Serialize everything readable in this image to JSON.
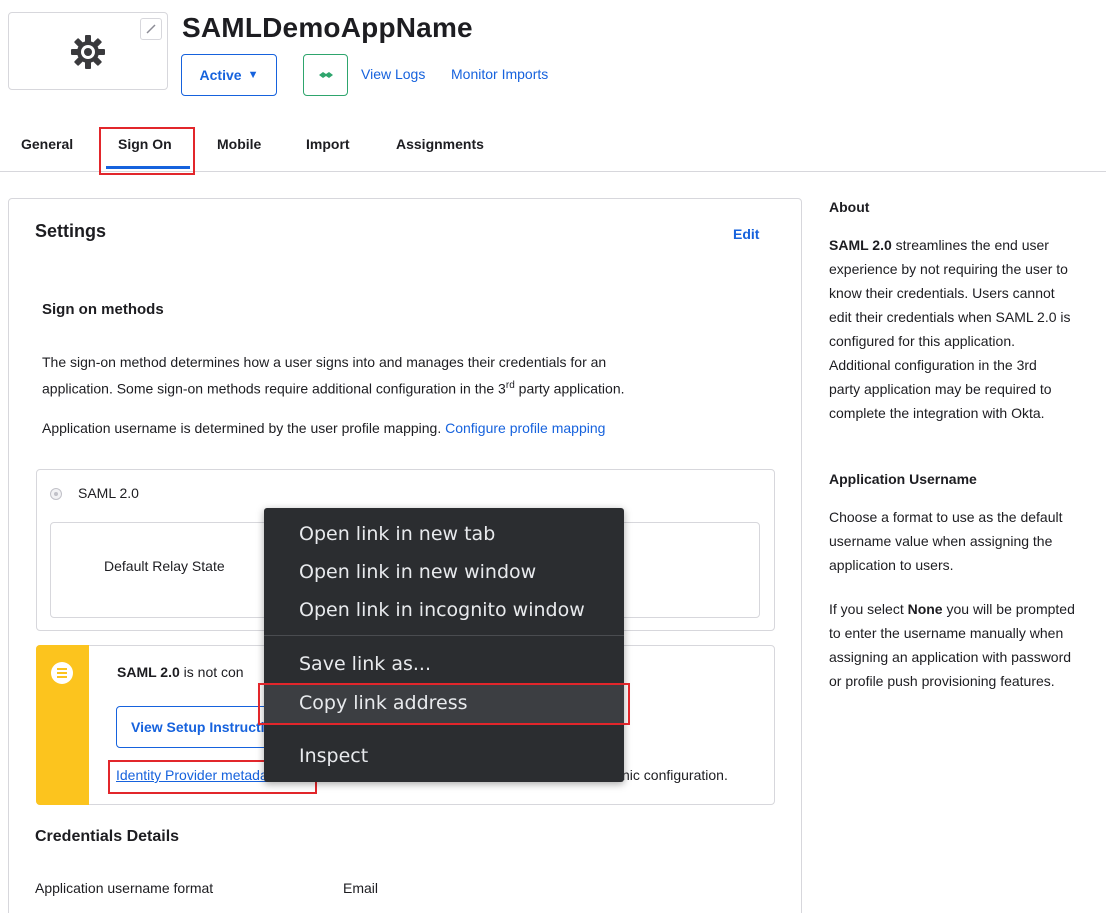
{
  "header": {
    "app_name": "SAMLDemoAppName",
    "status_label": "Active",
    "links": [
      "View Logs",
      "Monitor Imports"
    ]
  },
  "tabs": [
    "General",
    "Sign On",
    "Mobile",
    "Import",
    "Assignments"
  ],
  "active_tab": "Sign On",
  "settings": {
    "title": "Settings",
    "edit_label": "Edit",
    "sign_on_heading": "Sign on methods",
    "desc_line1": "The sign-on method determines how a user signs into and manages their credentials for an",
    "desc_line2_pre": "application. Some sign-on methods require additional configuration in the 3",
    "desc_line2_sup": "rd",
    "desc_line2_post": " party application.",
    "username_text": "Application username is determined by the user profile mapping.",
    "configure_link": "Configure profile mapping",
    "saml_option": "SAML 2.0",
    "relay_label": "Default Relay State",
    "callout_bold": "SAML 2.0",
    "callout_text": " is not con",
    "setup_button": "View Setup Instructions",
    "idp_link": "Identity Provider metadata",
    "idp_tail": "nic configuration.",
    "credentials_heading": "Credentials Details",
    "cred_label": "Application username format",
    "cred_value": "Email"
  },
  "context_menu": {
    "items": [
      "Open link in new tab",
      "Open link in new window",
      "Open link in incognito window",
      "Save link as...",
      "Copy link address",
      "Inspect"
    ]
  },
  "sidebar": {
    "about_heading": "About",
    "about_bold": "SAML 2.0",
    "about_lines": [
      " streamlines the end user",
      "experience by not requiring the user to",
      "know their credentials. Users cannot",
      "edit their credentials when SAML 2.0 is",
      "configured for this application.",
      "Additional configuration in the 3rd",
      "party application may be required to",
      "complete the integration with Okta."
    ],
    "username_heading": "Application Username",
    "username_lines": [
      "Choose a format to use as the default",
      "username value when assigning the",
      "application to users."
    ],
    "none_pre": "If you select ",
    "none_bold": "None",
    "none_post": " you will be prompted",
    "none_lines": [
      "to enter the username manually when",
      "assigning an application with password",
      "or profile push provisioning features."
    ]
  },
  "colors": {
    "accent": "#1662dd",
    "warning": "#fcc41e",
    "highlight": "#e2262b",
    "menu_bg": "#2b2d30"
  }
}
